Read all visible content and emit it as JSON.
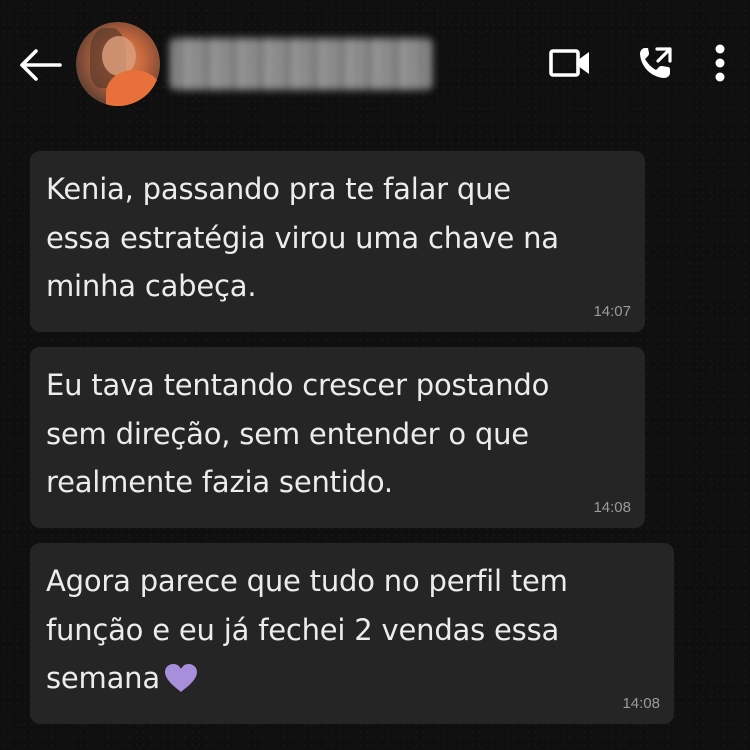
{
  "header": {
    "contact_name": "•••••••••••",
    "icons": {
      "back": "arrow-left-icon",
      "video": "video-camera-icon",
      "call": "phone-call-icon",
      "menu": "more-vertical-icon"
    }
  },
  "messages": [
    {
      "text": "Kenia, passando pra te falar que\nessa estratégia virou uma chave na\nminha cabeça.",
      "time": "14:07"
    },
    {
      "text": "Eu tava tentando crescer postando\nsem direção, sem entender o que\nrealmente fazia sentido.",
      "time": "14:08"
    },
    {
      "text": "Agora parece que tudo no perfil tem\nfunção e eu já fechei 2 vendas essa\nsemana",
      "emoji": "purple-heart",
      "time": "14:08"
    }
  ],
  "colors": {
    "background": "#0f0f0f",
    "bubble": "#252525",
    "text": "#ececec",
    "timestamp": "#9a9a9a",
    "heart": "#a88fdc"
  }
}
